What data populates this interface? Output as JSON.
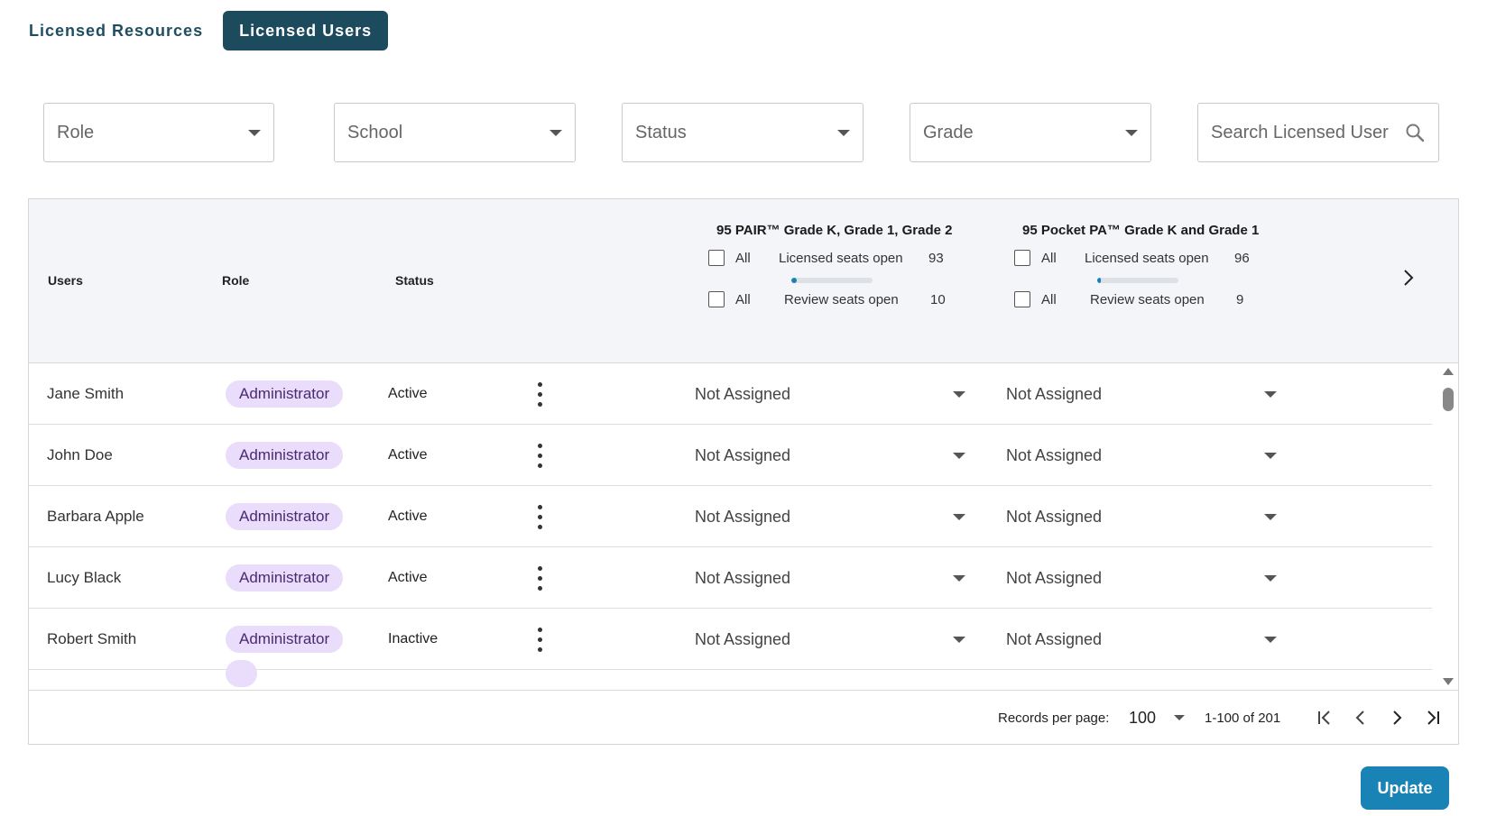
{
  "tabs": [
    {
      "label": "Licensed Resources",
      "active": false
    },
    {
      "label": "Licensed Users",
      "active": true
    }
  ],
  "filters": {
    "role": "Role",
    "school": "School",
    "status": "Status",
    "grade": "Grade",
    "search_placeholder": "Search Licensed User"
  },
  "table": {
    "headers": {
      "users": "Users",
      "role": "Role",
      "status": "Status"
    },
    "products": [
      {
        "title": "95 PAIR™ Grade K, Grade 1, Grade 2",
        "all_label": "All",
        "licensed_label": "Licensed seats open",
        "licensed_value": "93",
        "licensed_progress": 0.07,
        "review_label": "Review seats open",
        "review_value": "10"
      },
      {
        "title": "95 Pocket PA™ Grade K and Grade 1",
        "all_label": "All",
        "licensed_label": "Licensed seats open",
        "licensed_value": "96",
        "licensed_progress": 0.04,
        "review_label": "Review seats open",
        "review_value": "9"
      }
    ],
    "rows": [
      {
        "name": "Jane Smith",
        "role": "Administrator",
        "status": "Active",
        "p1": "Not Assigned",
        "p2": "Not Assigned"
      },
      {
        "name": "John Doe",
        "role": "Administrator",
        "status": "Active",
        "p1": "Not Assigned",
        "p2": "Not Assigned"
      },
      {
        "name": "Barbara Apple",
        "role": "Administrator",
        "status": "Active",
        "p1": "Not Assigned",
        "p2": "Not Assigned"
      },
      {
        "name": "Lucy Black",
        "role": "Administrator",
        "status": "Active",
        "p1": "Not Assigned",
        "p2": "Not Assigned"
      },
      {
        "name": "Robert Smith",
        "role": "Administrator",
        "status": "Inactive",
        "p1": "Not Assigned",
        "p2": "Not Assigned"
      }
    ]
  },
  "pagination": {
    "records_label": "Records per page:",
    "per_page": "100",
    "range": "1-100 of 201"
  },
  "actions": {
    "update_label": "Update"
  },
  "colors": {
    "accent": "#1d4b5e",
    "primary_button": "#1a83b5",
    "pill_bg": "#eadcfb"
  }
}
